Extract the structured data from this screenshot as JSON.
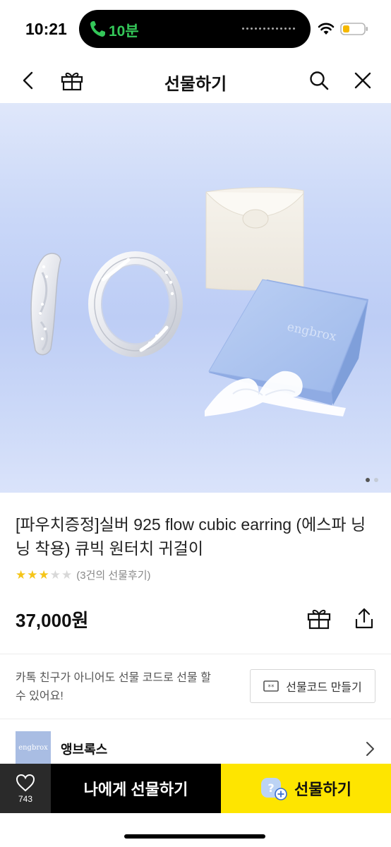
{
  "status_bar": {
    "time": "10:21",
    "call_timer": "10분",
    "icons": [
      "phone-icon",
      "wifi-icon",
      "battery-icon"
    ]
  },
  "nav": {
    "title": "선물하기",
    "icons": [
      "back-icon",
      "gift-icon",
      "search-icon",
      "close-icon"
    ]
  },
  "hero": {
    "box_logo_text": "engbrox",
    "page_count": 2,
    "active_page": 1
  },
  "product": {
    "title": "[파우치증정]실버 925 flow cubic earring (에스파 닝닝 착용) 큐빅 원터치 귀걸이",
    "rating": 3,
    "rating_max": 5,
    "review_text": "(3건의 선물후기)",
    "price": "37,000원",
    "actions": [
      "gift-box-icon",
      "share-icon"
    ]
  },
  "gift_code": {
    "description": "카톡 친구가 아니어도 선물 코드로 선물 할 수 있어요!",
    "button_label": "선물코드 만들기"
  },
  "brand": {
    "logo_text": "engbrox",
    "name": "앵브록스"
  },
  "bottom_bar": {
    "wish_count": "743",
    "gift_self_label": "나에게 선물하기",
    "gift_label": "선물하기"
  },
  "colors": {
    "kakao_yellow": "#fee500",
    "star": "#f5c518",
    "hero_bg": "#c9d7f8",
    "box_blue": "#a9c1ee",
    "call_green": "#34c759"
  }
}
